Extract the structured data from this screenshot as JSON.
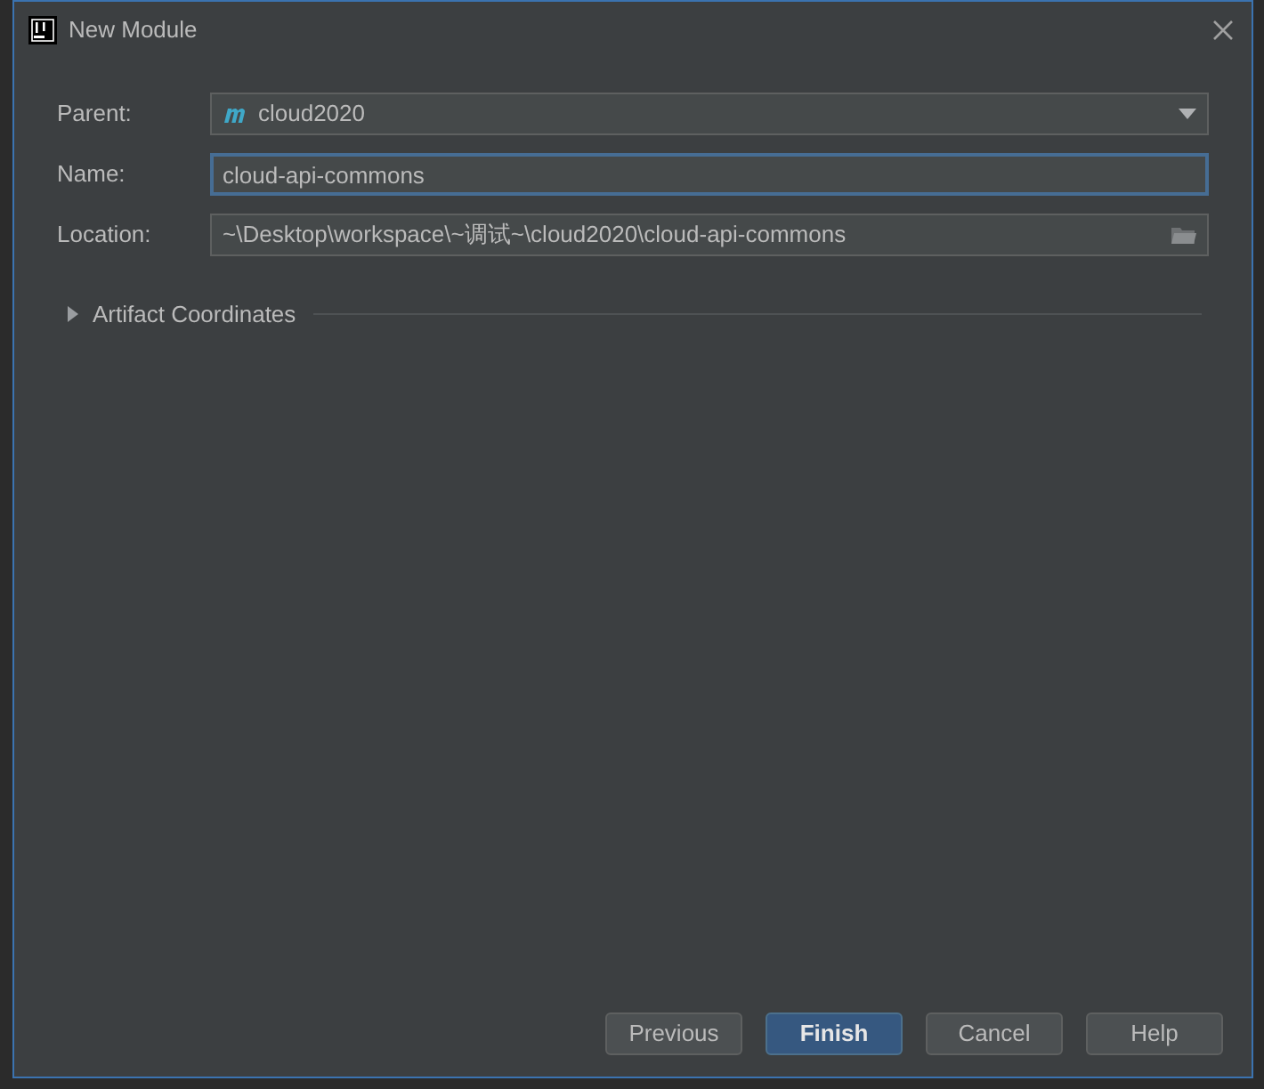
{
  "window": {
    "title": "New Module"
  },
  "fields": [
    {
      "kind": "dropdown",
      "label": "Parent:",
      "value": "cloud2020",
      "focused": false
    },
    {
      "kind": "text",
      "label": "Name:",
      "value": "cloud-api-commons",
      "focused": true
    },
    {
      "kind": "path",
      "label": "Location:",
      "value": "~\\Desktop\\workspace\\~调试~\\cloud2020\\cloud-api-commons",
      "focused": false
    }
  ],
  "section": {
    "label": "Artifact Coordinates",
    "expanded": false
  },
  "buttons": [
    {
      "label": "Previous",
      "default": false
    },
    {
      "label": "Finish",
      "default": true
    },
    {
      "label": "Cancel",
      "default": false
    },
    {
      "label": "Help",
      "default": false
    }
  ]
}
